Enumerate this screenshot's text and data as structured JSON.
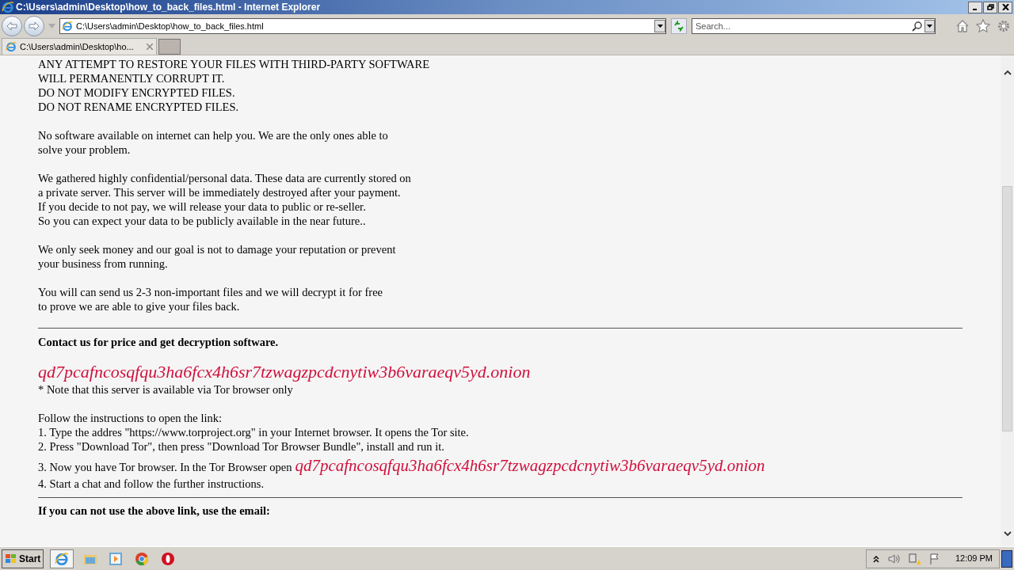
{
  "window": {
    "title": "C:\\Users\\admin\\Desktop\\how_to_back_files.html - Internet Explorer"
  },
  "address_bar": {
    "value": "C:\\Users\\admin\\Desktop\\how_to_back_files.html"
  },
  "search": {
    "placeholder": "Search..."
  },
  "tabs": [
    {
      "label": "C:\\Users\\admin\\Desktop\\ho...",
      "selected": true
    }
  ],
  "page": {
    "paragraphs": [
      [
        "ANY ATTEMPT TO RESTORE YOUR FILES WITH THIRD-PARTY SOFTWARE",
        "WILL PERMANENTLY CORRUPT IT.",
        "DO NOT MODIFY ENCRYPTED FILES.",
        "DO NOT RENAME ENCRYPTED FILES."
      ],
      [
        "No software available on internet can help you. We are the only ones able to",
        "solve your problem."
      ],
      [
        "We gathered highly confidential/personal data. These data are currently stored on",
        "a private server. This server will be immediately destroyed after your payment.",
        "If you decide to not pay, we will release your data to public or re-seller.",
        "So you can expect your data to be publicly available in the near future.."
      ],
      [
        "We only seek money and our goal is not to damage your reputation or prevent",
        "your business from running."
      ],
      [
        "You will can send us 2-3 non-important files and we will decrypt it for free",
        "to prove we are able to give your files back."
      ]
    ],
    "contact_heading": "Contact us for price and get decryption software.",
    "onion_link": "qd7pcafncosqfqu3ha6fcx4h6sr7tzwagzpcdcnytiw3b6varaeqv5yd.onion",
    "note": "* Note that this server is available via Tor browser only",
    "instructions_heading": "Follow the instructions to open the link:",
    "steps": [
      {
        "text": "1. Type the addres \"https://www.torproject.org\" in your Internet browser. It opens the Tor site."
      },
      {
        "text": "2. Press \"Download Tor\", then press \"Download Tor Browser Bundle\", install and run it."
      },
      {
        "text": "3. Now you have Tor browser. In the Tor Browser open",
        "link": "qd7pcafncosqfqu3ha6fcx4h6sr7tzwagzpcdcnytiw3b6varaeqv5yd.onion"
      },
      {
        "text": "4. Start a chat and follow the further instructions."
      }
    ],
    "email_heading": "If you can not use the above link, use the email:"
  },
  "taskbar": {
    "start": "Start",
    "clock": "12:09 PM"
  }
}
